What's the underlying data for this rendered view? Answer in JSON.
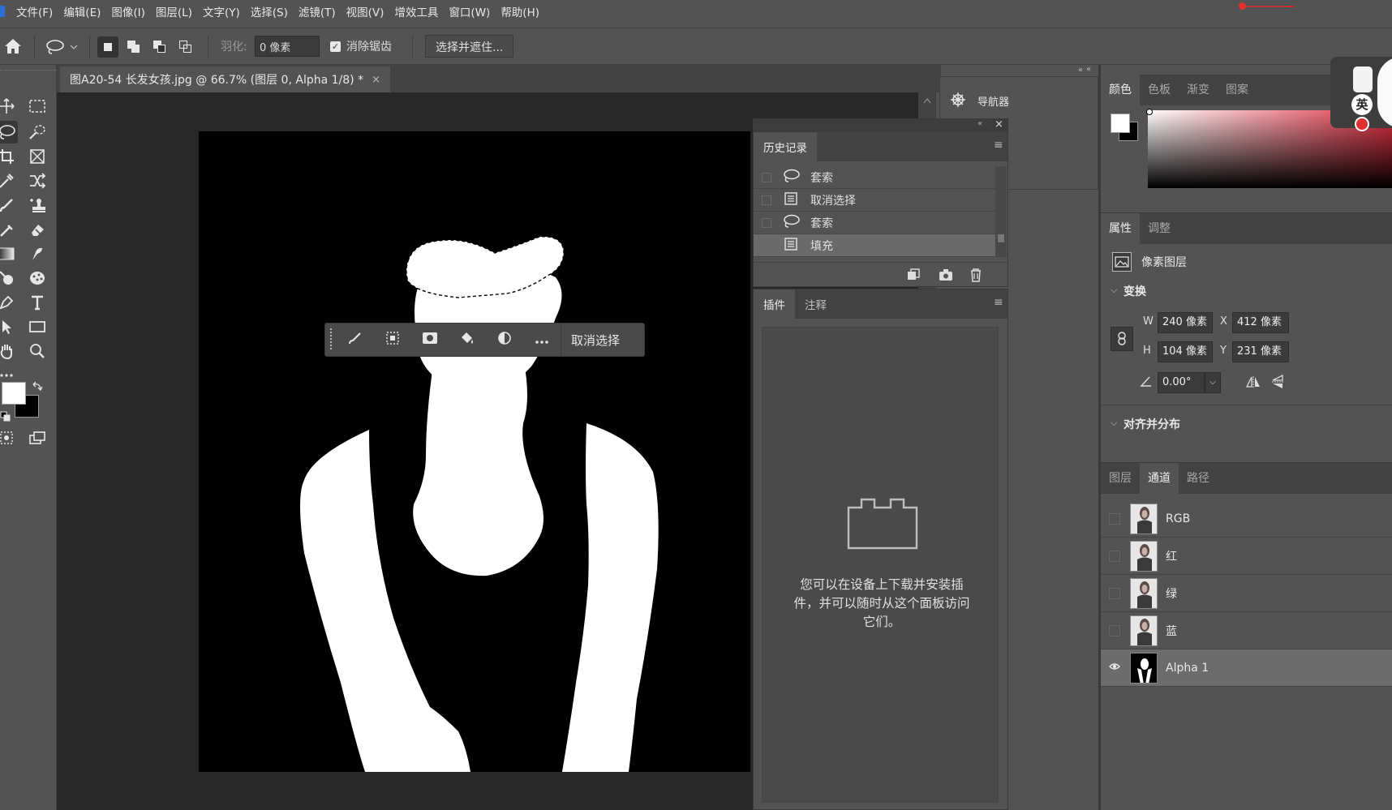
{
  "menubar": {
    "items": [
      "文件(F)",
      "编辑(E)",
      "图像(I)",
      "图层(L)",
      "文字(Y)",
      "选择(S)",
      "滤镜(T)",
      "视图(V)",
      "增效工具",
      "窗口(W)",
      "帮助(H)"
    ]
  },
  "options": {
    "feather_label": "羽化:",
    "feather_value": "0 像素",
    "antialias_label": "消除锯齿",
    "antialias_checked": true,
    "select_mask_label": "选择并遮住..."
  },
  "document": {
    "tab_title": "图A20-54 长发女孩.jpg @ 66.7% (图层 0, Alpha 1/8) *",
    "close_glyph": "×"
  },
  "contextbar": {
    "deselect_label": "取消选择"
  },
  "navigator": {
    "title": "导航器"
  },
  "history": {
    "tab": "历史记录",
    "items": [
      {
        "label": "套索",
        "icon": "lasso-icon",
        "active": false
      },
      {
        "label": "取消选择",
        "icon": "document-icon",
        "active": false
      },
      {
        "label": "套索",
        "icon": "lasso-icon",
        "active": false
      },
      {
        "label": "填充",
        "icon": "document-icon",
        "active": true
      }
    ]
  },
  "plugins": {
    "tabs": [
      "插件",
      "注释"
    ],
    "message": "您可以在设备上下载并安装插件，并可以随时从这个面板访问它们。"
  },
  "color_panel": {
    "tabs": [
      "颜色",
      "色板",
      "渐变",
      "图案"
    ],
    "foreground": "#ffffff",
    "background": "#000000"
  },
  "ime": {
    "label": "英"
  },
  "properties": {
    "tabs": [
      "属性",
      "调整"
    ],
    "layer_type": "像素图层",
    "transform_title": "变换",
    "w_label": "W",
    "w_value": "240 像素",
    "h_label": "H",
    "h_value": "104 像素",
    "x_label": "X",
    "x_value": "412 像素",
    "y_label": "Y",
    "y_value": "231 像素",
    "angle_value": "0.00°",
    "align_title": "对齐并分布"
  },
  "channels": {
    "tabs": [
      "图层",
      "通道",
      "路径"
    ],
    "items": [
      {
        "name": "RGB",
        "visible": false,
        "active": false
      },
      {
        "name": "红",
        "visible": false,
        "active": false
      },
      {
        "name": "绿",
        "visible": false,
        "active": false
      },
      {
        "name": "蓝",
        "visible": false,
        "active": false
      },
      {
        "name": "Alpha 1",
        "visible": true,
        "active": true
      }
    ]
  },
  "colors": {
    "accent_red": "#e03030",
    "panel_bg": "#535353",
    "canvas_bg": "#282828"
  }
}
